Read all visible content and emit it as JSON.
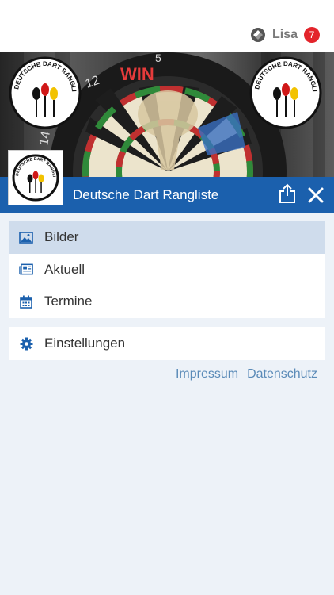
{
  "user": {
    "name": "Lisa",
    "badge_count": "7"
  },
  "header": {
    "title": "Deutsche Dart Rangliste",
    "logo_text": "DEUTSCHE DART RANGLISTE"
  },
  "banner": {
    "board_brand": "WIN",
    "numbers": [
      "12",
      "5",
      "14"
    ]
  },
  "menu": {
    "items": [
      {
        "label": "Bilder",
        "icon": "image-icon",
        "active": true
      },
      {
        "label": "Aktuell",
        "icon": "newspaper-icon",
        "active": false
      },
      {
        "label": "Termine",
        "icon": "calendar-icon",
        "active": false
      }
    ]
  },
  "settings": {
    "label": "Einstellungen",
    "icon": "gear-icon"
  },
  "footer": {
    "impressum": "Impressum",
    "datenschutz": "Datenschutz"
  },
  "colors": {
    "primary": "#1b60ad",
    "background": "#edf2f8",
    "active_item": "#cfdcec",
    "link": "#5b8bb8",
    "badge": "#e3242b",
    "icon": "#1b60ad"
  }
}
